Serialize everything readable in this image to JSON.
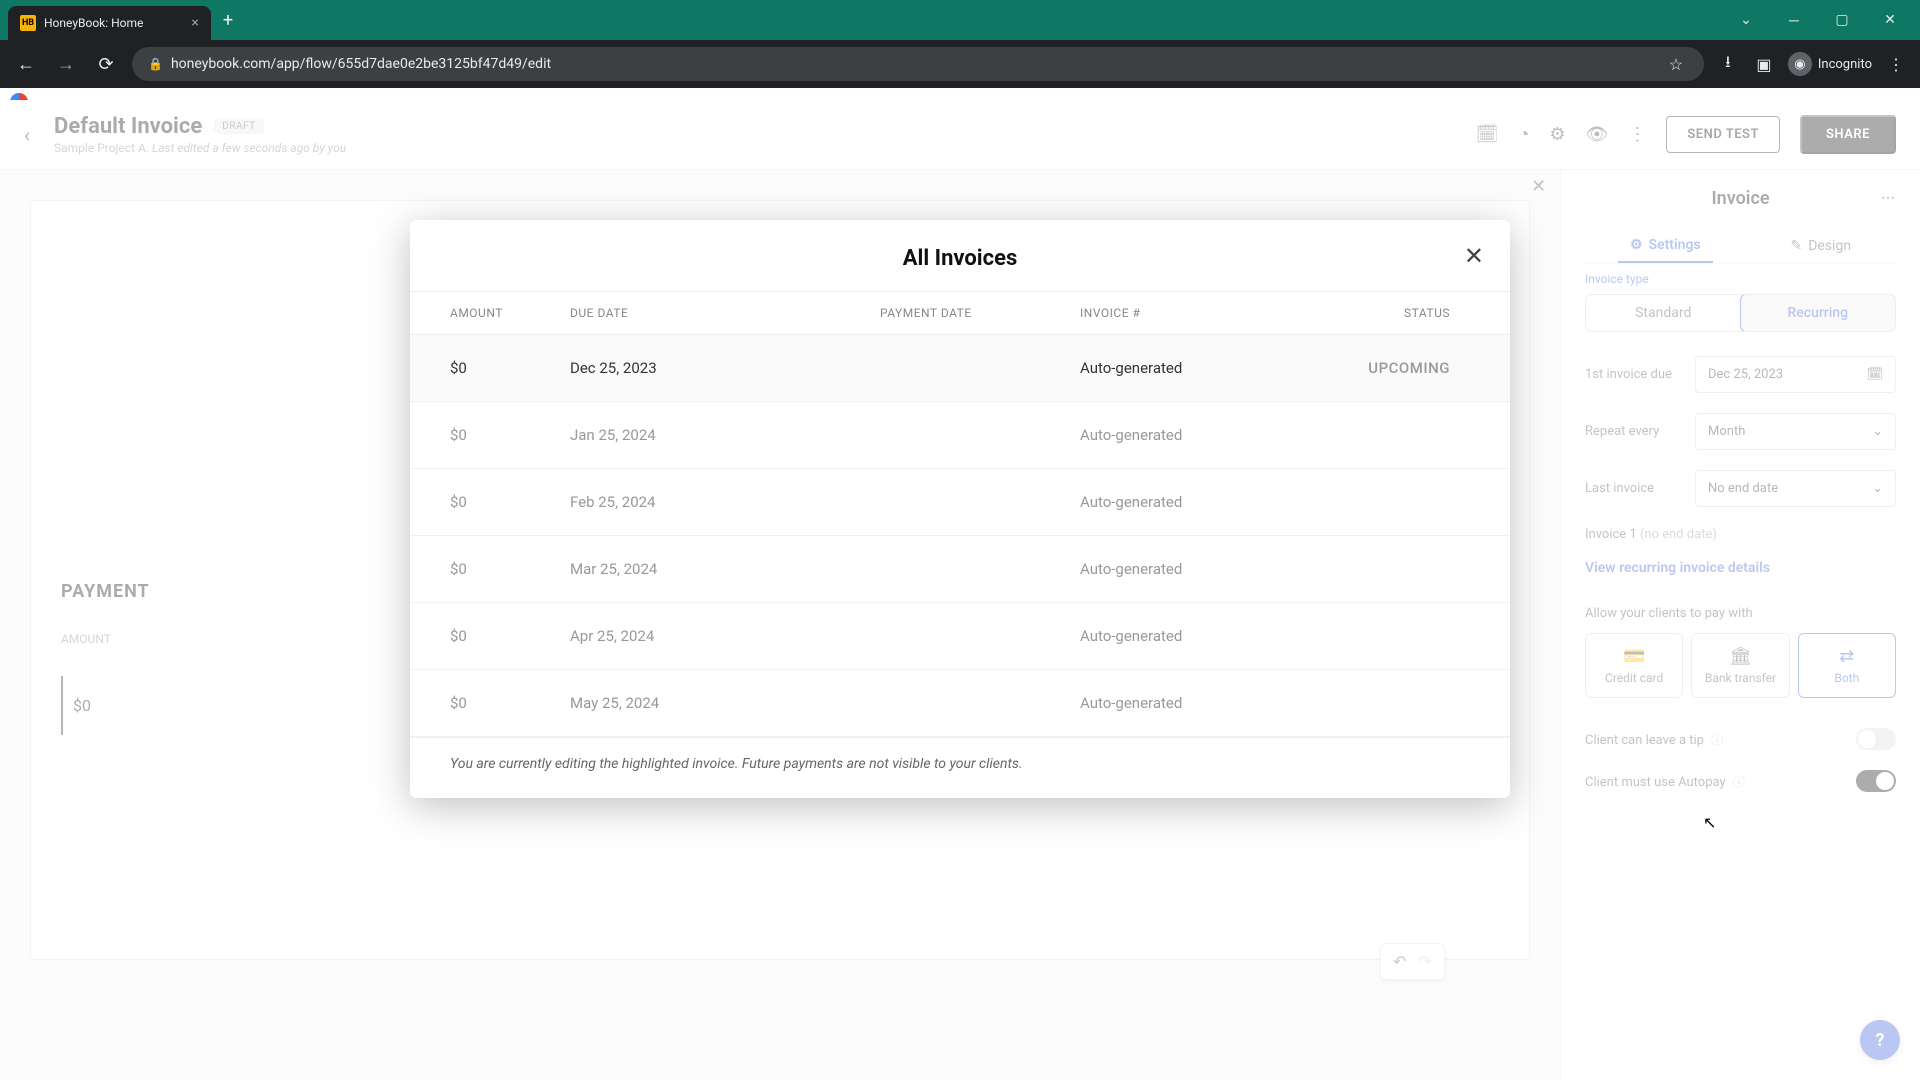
{
  "browser": {
    "tab_title": "HoneyBook: Home",
    "url": "honeybook.com/app/flow/655d7dae0e2be3125bf47d49/edit",
    "incognito_label": "Incognito"
  },
  "header": {
    "page_title": "Default Invoice",
    "draft_badge": "DRAFT",
    "project": "Sample Project A.",
    "last_edited": "Last edited a few seconds ago by you",
    "send_test": "SEND TEST",
    "share": "SHARE"
  },
  "canvas": {
    "payment_title": "PAYMENT",
    "amount_label": "AMOUNT",
    "amount_value": "$0"
  },
  "sidebar": {
    "title": "Invoice",
    "tabs": {
      "settings": "Settings",
      "design": "Design"
    },
    "invoice_type_label": "Invoice type",
    "type_standard": "Standard",
    "type_recurring": "Recurring",
    "first_invoice_due_label": "1st invoice due",
    "first_invoice_due_value": "Dec 25, 2023",
    "repeat_label": "Repeat every",
    "repeat_value": "Month",
    "last_invoice_label": "Last invoice",
    "last_invoice_value": "No end date",
    "invoice_count_text": "Invoice 1",
    "invoice_count_note": "(no end date)",
    "view_details_link": "View recurring invoice details",
    "pay_with_label": "Allow your clients to pay with",
    "pay_credit": "Credit card",
    "pay_bank": "Bank transfer",
    "pay_both": "Both",
    "tip_label": "Client can leave a tip",
    "autopay_label": "Client must use Autopay"
  },
  "modal": {
    "title": "All Invoices",
    "columns": {
      "amount": "AMOUNT",
      "due_date": "DUE DATE",
      "payment_date": "PAYMENT DATE",
      "invoice_num": "INVOICE #",
      "status": "STATUS"
    },
    "rows": [
      {
        "amount": "$0",
        "due": "Dec 25, 2023",
        "pdate": "",
        "inv": "Auto-generated",
        "status": "UPCOMING",
        "active": true
      },
      {
        "amount": "$0",
        "due": "Jan 25, 2024",
        "pdate": "",
        "inv": "Auto-generated",
        "status": "",
        "active": false
      },
      {
        "amount": "$0",
        "due": "Feb 25, 2024",
        "pdate": "",
        "inv": "Auto-generated",
        "status": "",
        "active": false
      },
      {
        "amount": "$0",
        "due": "Mar 25, 2024",
        "pdate": "",
        "inv": "Auto-generated",
        "status": "",
        "active": false
      },
      {
        "amount": "$0",
        "due": "Apr 25, 2024",
        "pdate": "",
        "inv": "Auto-generated",
        "status": "",
        "active": false
      },
      {
        "amount": "$0",
        "due": "May 25, 2024",
        "pdate": "",
        "inv": "Auto-generated",
        "status": "",
        "active": false
      }
    ],
    "footer_note": "You are currently editing the highlighted invoice. Future payments are not visible to your clients."
  }
}
